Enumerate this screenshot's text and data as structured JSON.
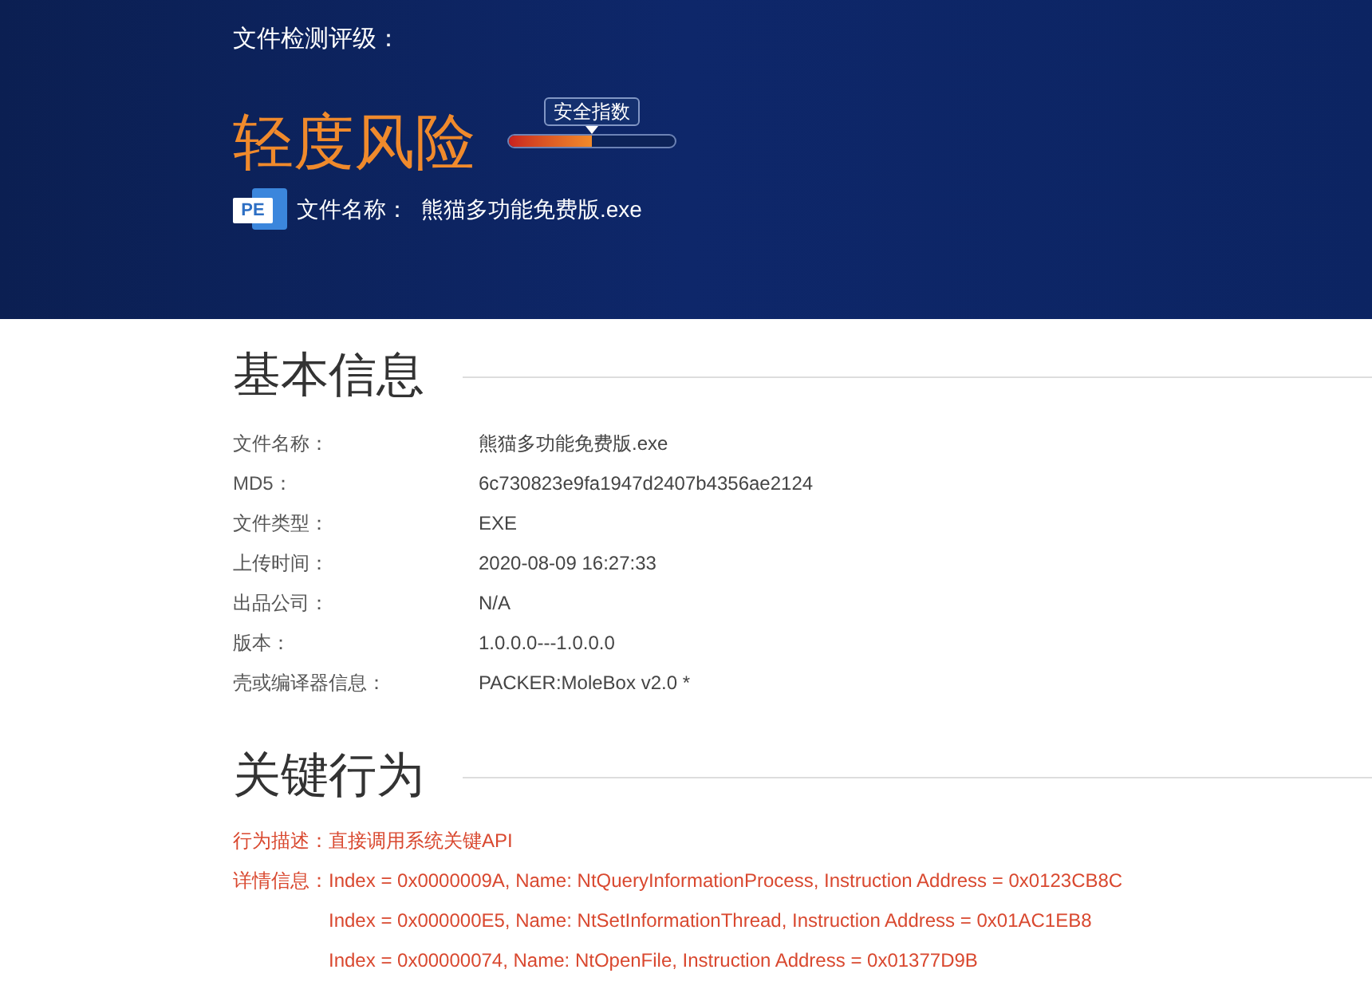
{
  "header": {
    "rating_label": "文件检测评级：",
    "rating": "轻度风险",
    "safety_index": {
      "label": "安全指数",
      "level": 0.5
    },
    "file_icon_label": "PE",
    "file_name_label": "文件名称：",
    "file_name": "熊猫多功能免费版.exe"
  },
  "basic_info": {
    "title": "基本信息",
    "rows": [
      {
        "label": "文件名称：",
        "value": "熊猫多功能免费版.exe"
      },
      {
        "label": "MD5：",
        "value": "6c730823e9fa1947d2407b4356ae2124"
      },
      {
        "label": "文件类型：",
        "value": "EXE"
      },
      {
        "label": "上传时间：",
        "value": "2020-08-09 16:27:33"
      },
      {
        "label": "出品公司：",
        "value": "N/A"
      },
      {
        "label": "版本：",
        "value": "1.0.0.0---1.0.0.0"
      },
      {
        "label": "壳或编译器信息：",
        "value": "PACKER:MoleBox v2.0 *"
      }
    ]
  },
  "key_behaviors": {
    "title": "关键行为",
    "items": [
      {
        "label": "行为描述：",
        "lines": [
          "直接调用系统关键API"
        ]
      },
      {
        "label": "详情信息：",
        "lines": [
          "Index = 0x0000009A, Name: NtQueryInformationProcess, Instruction Address = 0x0123CB8C",
          "Index = 0x000000E5, Name: NtSetInformationThread, Instruction Address = 0x01AC1EB8",
          "Index = 0x00000074, Name: NtOpenFile, Instruction Address = 0x01377D9B"
        ]
      }
    ]
  }
}
